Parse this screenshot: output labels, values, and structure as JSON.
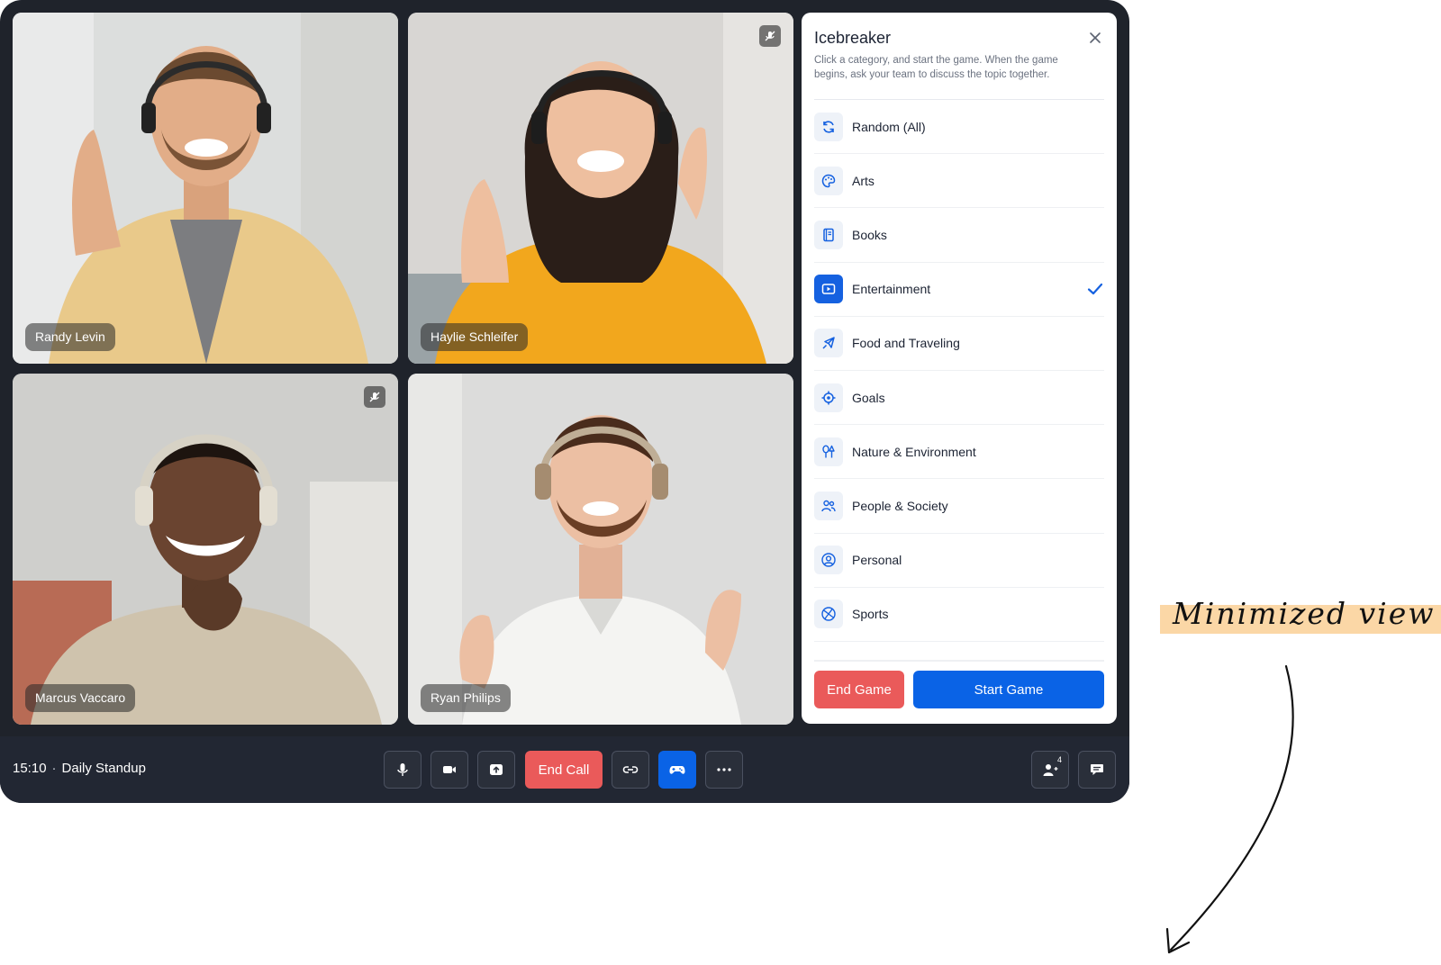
{
  "meeting": {
    "time": "15:10",
    "separator": "·",
    "title": "Daily Standup"
  },
  "participants": [
    {
      "name": "Randy Levin",
      "muted": false
    },
    {
      "name": "Haylie Schleifer",
      "muted": true
    },
    {
      "name": "Marcus Vaccaro",
      "muted": true
    },
    {
      "name": "Ryan Philips",
      "muted": false
    }
  ],
  "icebreaker": {
    "title": "Icebreaker",
    "description": "Click a category, and start the game. When the game begins, ask your team to discuss the topic together.",
    "categories": [
      {
        "label": "Random (All)",
        "icon": "refresh-icon"
      },
      {
        "label": "Arts",
        "icon": "palette-icon"
      },
      {
        "label": "Books",
        "icon": "book-icon"
      },
      {
        "label": "Entertainment",
        "icon": "play-icon",
        "selected": true
      },
      {
        "label": "Food and Traveling",
        "icon": "plane-icon"
      },
      {
        "label": "Goals",
        "icon": "target-icon"
      },
      {
        "label": "Nature & Environment",
        "icon": "tree-icon"
      },
      {
        "label": "People & Society",
        "icon": "people-icon"
      },
      {
        "label": "Personal",
        "icon": "user-circle-icon"
      },
      {
        "label": "Sports",
        "icon": "ball-icon"
      }
    ],
    "end_game_label": "End Game",
    "start_game_label": "Start Game"
  },
  "controls": {
    "end_call_label": "End Call",
    "participants_count": "4"
  },
  "colors": {
    "accent": "#0a63e6",
    "danger": "#ea5a5a",
    "dark_bg": "#1f232b"
  },
  "annotation": {
    "label": "Minimized view"
  }
}
